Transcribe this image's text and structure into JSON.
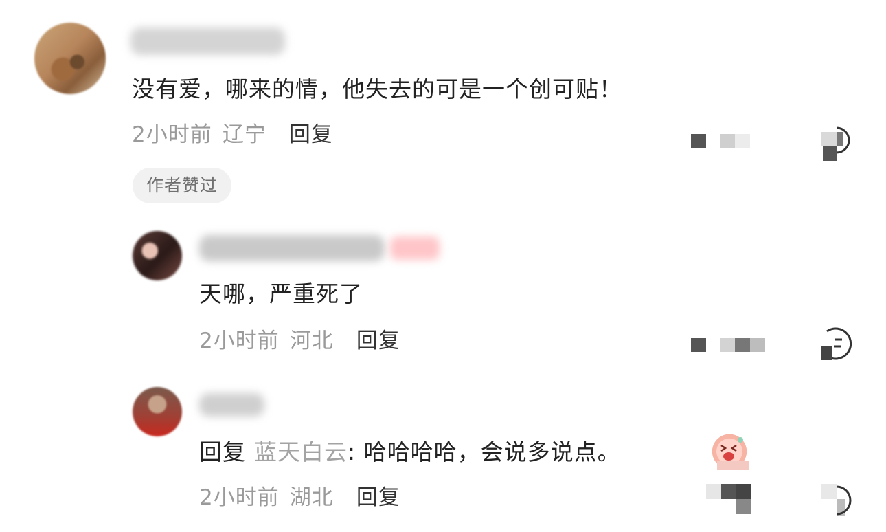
{
  "comments": [
    {
      "text": "没有爱，哪来的情，他失去的可是一个创可贴！",
      "time": "2小时前",
      "location": "辽宁",
      "reply_label": "回复",
      "author_liked": "作者赞过"
    },
    {
      "text": "天哪，严重死了",
      "time": "2小时前",
      "location": "河北",
      "reply_label": "回复"
    },
    {
      "reply_prefix": "回复",
      "reply_target": "蓝天白云",
      "text": ": 哈哈哈哈，会说多说点。",
      "time": "2小时前",
      "location": "湖北",
      "reply_label": "回复"
    }
  ],
  "icons": {
    "comment_more": "more-icon",
    "emoji": "emoji-icon"
  },
  "colors": {
    "meta_gray": "#9a9a9a",
    "tag_bg": "#f1f1f1",
    "reply_target": "#a3a3a3"
  }
}
